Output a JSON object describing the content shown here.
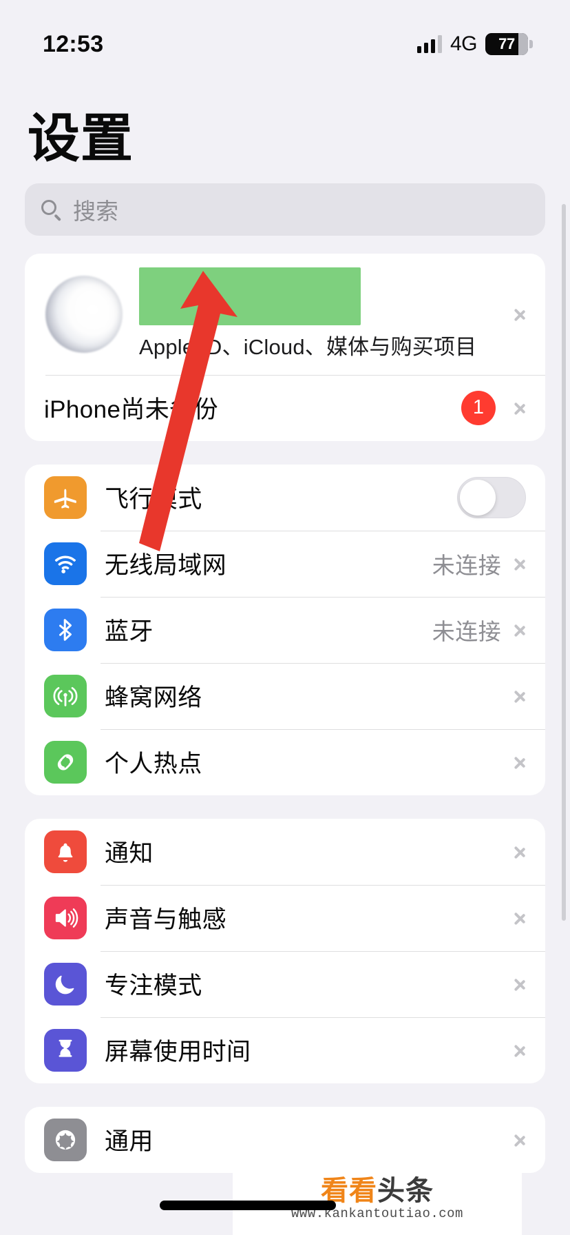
{
  "status_bar": {
    "time": "12:53",
    "network": "4G",
    "battery_percent": "77",
    "signal_icon": "signal-bars-icon",
    "battery_icon": "battery-icon"
  },
  "header": {
    "title": "设置"
  },
  "search": {
    "placeholder": "搜索",
    "value": "",
    "icon": "search-icon"
  },
  "account_group": {
    "apple_id_row": {
      "name_redacted": true,
      "subtitle": "Apple ID、iCloud、媒体与购买项目",
      "avatar_icon": "avatar",
      "chevron_icon": "chevron-right-icon"
    },
    "backup_row": {
      "label": "iPhone尚未备份",
      "badge": "1",
      "chevron_icon": "chevron-right-icon"
    }
  },
  "connectivity_group": {
    "rows": [
      {
        "label": "飞行模式",
        "icon": "airplane-icon",
        "icon_color": "#f09a2e",
        "control": "toggle",
        "toggle_on": false
      },
      {
        "label": "无线局域网",
        "icon": "wifi-icon",
        "icon_color": "#1a74e8",
        "value": "未连接",
        "control": "chevron"
      },
      {
        "label": "蓝牙",
        "icon": "bluetooth-icon",
        "icon_color": "#2d7cf0",
        "value": "未连接",
        "control": "chevron"
      },
      {
        "label": "蜂窝网络",
        "icon": "cellular-antenna-icon",
        "icon_color": "#5bc75b",
        "value": "",
        "control": "chevron"
      },
      {
        "label": "个人热点",
        "icon": "personal-hotspot-icon",
        "icon_color": "#5bc75b",
        "value": "",
        "control": "chevron"
      }
    ]
  },
  "notifications_group": {
    "rows": [
      {
        "label": "通知",
        "icon": "bell-icon",
        "icon_color": "#ef4b3c",
        "control": "chevron"
      },
      {
        "label": "声音与触感",
        "icon": "speaker-icon",
        "icon_color": "#ef3b57",
        "control": "chevron"
      },
      {
        "label": "专注模式",
        "icon": "moon-icon",
        "icon_color": "#5a55d6",
        "control": "chevron"
      },
      {
        "label": "屏幕使用时间",
        "icon": "hourglass-icon",
        "icon_color": "#5a55d6",
        "control": "chevron"
      }
    ]
  },
  "general_group": {
    "rows": [
      {
        "label": "通用",
        "icon": "gear-icon",
        "icon_color": "#8e8e93",
        "control": "chevron"
      }
    ]
  },
  "annotation": {
    "arrow_color": "#e8372c",
    "redaction_color": "#7ed07e",
    "description": "red-arrow-pointing-to-apple-id-name"
  },
  "watermark": {
    "logo_orange": "看看",
    "logo_dark": "头条",
    "url": "www.kankantoutiao.com"
  }
}
